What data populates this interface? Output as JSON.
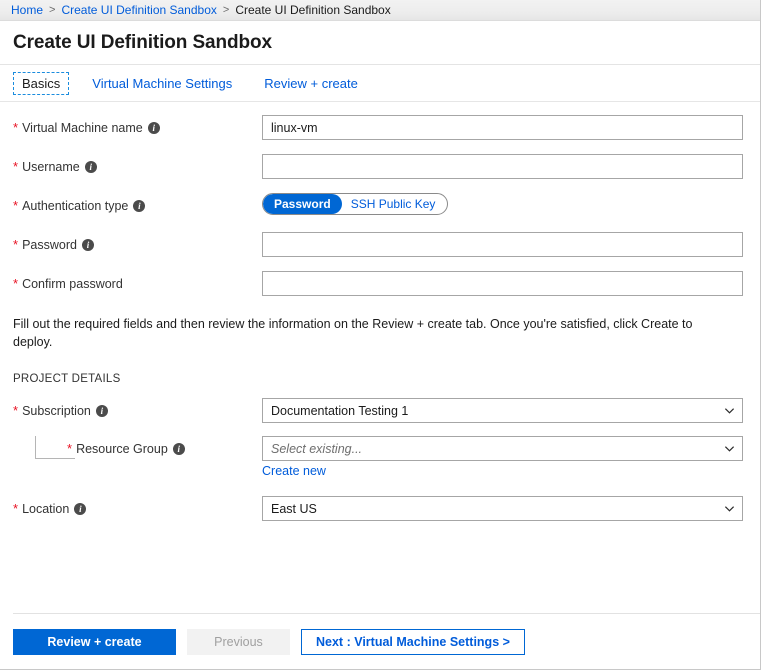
{
  "breadcrumb": {
    "items": [
      {
        "label": "Home",
        "link": true
      },
      {
        "label": "Create UI Definition Sandbox",
        "link": true
      },
      {
        "label": "Create UI Definition Sandbox",
        "link": false
      }
    ],
    "separator": ">"
  },
  "header": {
    "title": "Create UI Definition Sandbox"
  },
  "tabs": [
    {
      "label": "Basics",
      "active": true
    },
    {
      "label": "Virtual Machine Settings",
      "active": false
    },
    {
      "label": "Review + create",
      "active": false
    }
  ],
  "form": {
    "vm_name": {
      "label": "Virtual Machine name",
      "required_marker": "*",
      "info_icon": "info-icon",
      "value": "linux-vm"
    },
    "username": {
      "label": "Username",
      "required_marker": "*",
      "info_icon": "info-icon",
      "value": ""
    },
    "auth_type": {
      "label": "Authentication type",
      "required_marker": "*",
      "info_icon": "info-icon",
      "options": [
        "Password",
        "SSH Public Key"
      ],
      "selected": "Password"
    },
    "password": {
      "label": "Password",
      "required_marker": "*",
      "info_icon": "info-icon",
      "value": ""
    },
    "confirm_password": {
      "label": "Confirm password",
      "required_marker": "*",
      "value": ""
    }
  },
  "description": "Fill out the required fields and then review the information on the Review + create tab. Once you're satisfied, click Create to deploy.",
  "project_details": {
    "section_title": "PROJECT DETAILS",
    "subscription": {
      "label": "Subscription",
      "required_marker": "*",
      "info_icon": "info-icon",
      "value": "Documentation Testing 1",
      "chevron_icon": "chevron-down-icon"
    },
    "resource_group": {
      "label": "Resource Group",
      "required_marker": "*",
      "info_icon": "info-icon",
      "placeholder": "Select existing...",
      "value": "",
      "chevron_icon": "chevron-down-icon",
      "create_new_link": "Create new"
    },
    "location": {
      "label": "Location",
      "required_marker": "*",
      "info_icon": "info-icon",
      "value": "East US",
      "chevron_icon": "chevron-down-icon"
    }
  },
  "footer": {
    "review_create": "Review + create",
    "previous": "Previous",
    "next": "Next : Virtual Machine Settings >"
  },
  "colors": {
    "accent_blue": "#0067d4",
    "link_blue": "#015cda",
    "required_red": "#e81123",
    "border_gray": "#a6a6a6"
  }
}
